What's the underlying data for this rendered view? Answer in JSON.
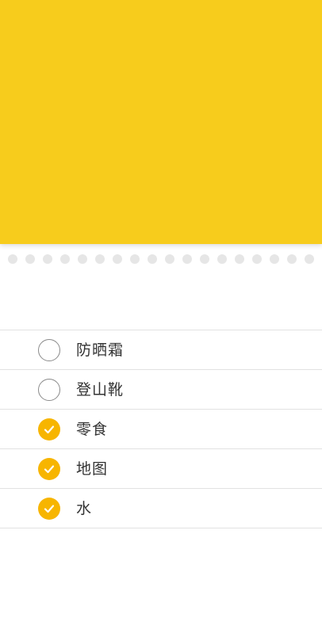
{
  "header": {
    "banner_color": "#f7cc1c"
  },
  "checklist": {
    "accent_color": "#f7b500",
    "items": [
      {
        "label": "防晒霜",
        "checked": false
      },
      {
        "label": "登山靴",
        "checked": false
      },
      {
        "label": "零食",
        "checked": true
      },
      {
        "label": "地图",
        "checked": true
      },
      {
        "label": "水",
        "checked": true
      }
    ]
  }
}
